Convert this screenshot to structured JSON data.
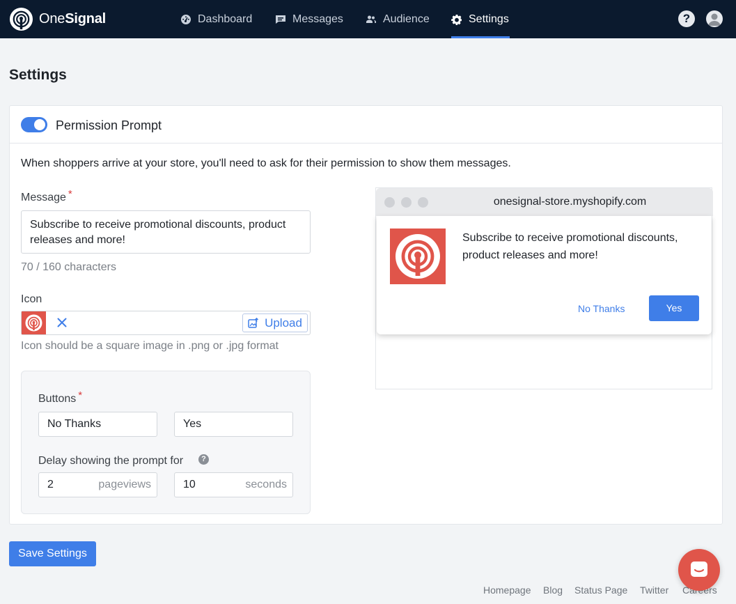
{
  "brand": {
    "name_light": "One",
    "name_bold": "Signal"
  },
  "nav": [
    {
      "label": "Dashboard",
      "icon": "dashboard-gauge-icon"
    },
    {
      "label": "Messages",
      "icon": "message-bubble-icon"
    },
    {
      "label": "Audience",
      "icon": "users-icon"
    },
    {
      "label": "Settings",
      "icon": "gear-icon",
      "active": true
    }
  ],
  "header": {
    "help": "?"
  },
  "page": {
    "title": "Settings"
  },
  "prompt_section": {
    "title": "Permission Prompt",
    "enabled": true,
    "intro": "When shoppers arrive at your store, you'll need to ask for their permission to show them messages.",
    "message_label": "Message",
    "required_mark": "*",
    "message_value": "Subscribe to receive promotional discounts, product releases and more!",
    "char_count": "70 / 160 characters",
    "icon_label": "Icon",
    "upload_label": "Upload",
    "icon_hint": "Icon should be a square image in .png or .jpg format",
    "buttons_label": "Buttons",
    "button_no_value": "No Thanks",
    "button_yes_value": "Yes",
    "delay_label": "Delay showing the prompt for",
    "delay_pageviews": "2",
    "pageviews_unit": "pageviews",
    "delay_seconds": "10",
    "seconds_unit": "seconds"
  },
  "preview": {
    "url": "onesignal-store.myshopify.com",
    "message": "Subscribe to receive promotional discounts, product releases and more!",
    "no_label": "No Thanks",
    "yes_label": "Yes"
  },
  "actions": {
    "save_label": "Save Settings"
  },
  "footer": [
    "Homepage",
    "Blog",
    "Status Page",
    "Twitter",
    "Careers"
  ],
  "colors": {
    "accent": "#3f7ee8",
    "brand_red": "#e0554a",
    "nav_bg": "#0b1a2e"
  }
}
